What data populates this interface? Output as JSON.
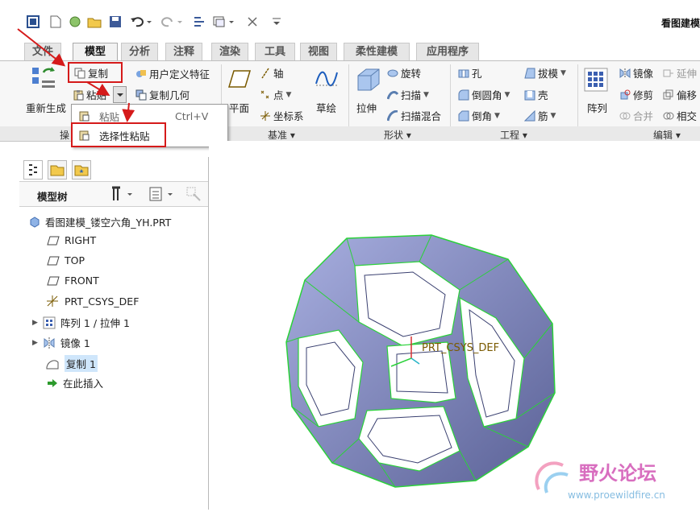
{
  "app": {
    "title": "看图建模"
  },
  "tabs": [
    {
      "label": "文件"
    },
    {
      "label": "模型"
    },
    {
      "label": "分析"
    },
    {
      "label": "注释"
    },
    {
      "label": "渲染"
    },
    {
      "label": "工具"
    },
    {
      "label": "视图"
    },
    {
      "label": "柔性建模"
    },
    {
      "label": "应用程序"
    }
  ],
  "ribbon": {
    "regen": "重新生成",
    "copy": "复制",
    "paste": "粘贴",
    "udf": "用户定义特征",
    "copy_geom": "复制几何",
    "plane": "平面",
    "axis": "轴",
    "point": "点",
    "csys": "坐标系",
    "sketch": "草绘",
    "extrude": "拉伸",
    "revolve": "旋转",
    "sweep": "扫描",
    "blend_sweep": "扫描混合",
    "hole": "孔",
    "round": "倒圆角",
    "chamfer": "倒角",
    "draft": "拔模",
    "shell": "壳",
    "rib": "筋",
    "pattern": "阵列",
    "mirror": "镜像",
    "trim": "修剪",
    "merge": "合并",
    "extend": "延伸",
    "offset": "偏移",
    "intersect": "相交"
  },
  "groups": {
    "operations": "操",
    "datum": "基准",
    "shapes": "形状",
    "engineering": "工程",
    "editing": "编辑"
  },
  "paste_menu": {
    "paste": "粘贴",
    "paste_shortcut": "Ctrl+V",
    "paste_special": "选择性粘贴"
  },
  "tree": {
    "header": "模型树",
    "root": "看图建模_镂空六角_YH.PRT",
    "items": [
      {
        "label": "RIGHT"
      },
      {
        "label": "TOP"
      },
      {
        "label": "FRONT"
      },
      {
        "label": "PRT_CSYS_DEF"
      },
      {
        "label": "阵列 1 / 拉伸 1"
      },
      {
        "label": "镜像 1"
      },
      {
        "label": "复制 1"
      },
      {
        "label": "在此插入"
      }
    ]
  },
  "viewport": {
    "csys_label": "PRT_CSYS_DEF"
  },
  "watermark": {
    "name": "野火论坛",
    "url": "www.proewildfire.cn"
  },
  "colors": {
    "annotation_red": "#d51a1a",
    "model_face": "#7d84b8",
    "model_edge": "#2bd13a"
  }
}
